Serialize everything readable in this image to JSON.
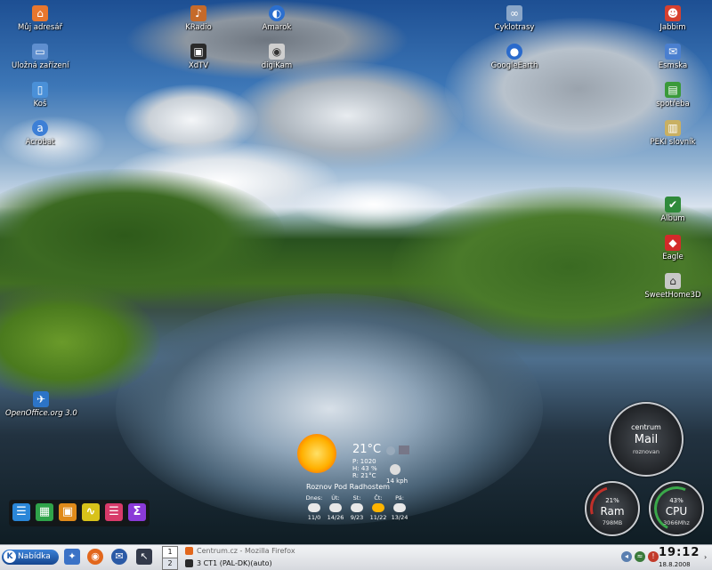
{
  "desktop_icons_left": [
    {
      "label": "Můj adresář",
      "icon": "home-icon",
      "color": "#e8772e",
      "glyph": "⌂"
    },
    {
      "label": "Uložná zařízení",
      "icon": "computer-icon",
      "color": "#5f8fcf",
      "glyph": "▭"
    },
    {
      "label": "Koš",
      "icon": "trash-icon",
      "color": "#4a90d8",
      "glyph": "▯"
    },
    {
      "label": "Acrobat",
      "icon": "adobe-acrobat-icon",
      "color": "#3d7fd6",
      "glyph": "a"
    }
  ],
  "desktop_icons_mid": [
    {
      "label": "KRadio",
      "icon": "radio-icon",
      "color": "#c56a2a",
      "glyph": "♪"
    },
    {
      "label": "XdTV",
      "icon": "tv-icon",
      "color": "#2a2a2a",
      "glyph": "▣"
    },
    {
      "label": "Amarok",
      "icon": "amarok-icon",
      "color": "#2b6fcf",
      "glyph": "◐"
    },
    {
      "label": "digiKam",
      "icon": "camera-icon",
      "color": "#cfcfcf",
      "glyph": "◉"
    },
    {
      "label": "Cyklotrasy",
      "icon": "bicycle-icon",
      "color": "#8aa6c8",
      "glyph": "∞"
    },
    {
      "label": "GoogleEarth",
      "icon": "globe-icon",
      "color": "#2a6acc",
      "glyph": "●"
    }
  ],
  "desktop_icons_right": [
    {
      "label": "Jabbim",
      "icon": "jabber-icon",
      "color": "#d6402f",
      "glyph": "☻"
    },
    {
      "label": "Esmska",
      "icon": "sms-icon",
      "color": "#4a7fcf",
      "glyph": "✉"
    },
    {
      "label": "spotřeba",
      "icon": "spreadsheet-icon",
      "color": "#3a9a3a",
      "glyph": "▤"
    },
    {
      "label": "PEKI slovník",
      "icon": "dictionary-icon",
      "color": "#c9b062",
      "glyph": "▥"
    },
    {
      "label": "Album",
      "icon": "album-icon",
      "color": "#2f8a3a",
      "glyph": "✔"
    },
    {
      "label": "Eagle",
      "icon": "eagle-icon",
      "color": "#d42a2a",
      "glyph": "◆"
    },
    {
      "label": "SweetHome3D",
      "icon": "house-3d-icon",
      "color": "#c8c8c8",
      "glyph": "⌂"
    }
  ],
  "openoffice": {
    "label": "OpenOffice.org 3.0",
    "icon": "openoffice-icon",
    "color": "#2c74c7",
    "glyph": "✈"
  },
  "weather": {
    "temperature": "21°C",
    "pressure": "P: 1020",
    "humidity": "H: 43 %",
    "realfeel": "R: 21°C",
    "wind": "14 kph",
    "city": "Roznov Pod Radhostem",
    "days": [
      {
        "day": "Dnes:",
        "range": "11/0",
        "sunny": false
      },
      {
        "day": "Út:",
        "range": "14/26",
        "sunny": false
      },
      {
        "day": "St:",
        "range": "9/23",
        "sunny": false
      },
      {
        "day": "Čt:",
        "range": "11/22",
        "sunny": true
      },
      {
        "day": "Pá:",
        "range": "13/24",
        "sunny": false
      }
    ]
  },
  "mail_widget": {
    "title": "centrum",
    "label": "Mail",
    "sub": "roznovan"
  },
  "ram_gauge": {
    "percent": "21%",
    "label": "Ram",
    "sub": "798MB",
    "fill": 0.21
  },
  "cpu_gauge": {
    "percent": "43%",
    "label": "CPU",
    "sub": "3066Mhz",
    "fill": 0.43
  },
  "dock": [
    {
      "icon": "list-icon",
      "color": "#2a86d8",
      "glyph": "☰"
    },
    {
      "icon": "grid-icon",
      "color": "#2fa34a",
      "glyph": "▦"
    },
    {
      "icon": "window-icon",
      "color": "#e08a1a",
      "glyph": "▣"
    },
    {
      "icon": "curve-icon",
      "color": "#d8c21a",
      "glyph": "∿"
    },
    {
      "icon": "database-icon",
      "color": "#d83a6a",
      "glyph": "☰"
    },
    {
      "icon": "sigma-icon",
      "color": "#8a3ad8",
      "glyph": "Σ"
    }
  ],
  "taskbar": {
    "start_label": "Nabídka",
    "quick_launch": [
      {
        "icon": "kde-icon",
        "color": "#3a72c6",
        "glyph": "✦"
      },
      {
        "icon": "firefox-icon",
        "color": "#e2671c",
        "glyph": "◉"
      },
      {
        "icon": "thunderbird-icon",
        "color": "#2a5aa6",
        "glyph": "✉"
      },
      {
        "icon": "show-desktop-icon",
        "color": "#333a4a",
        "glyph": "↖"
      }
    ],
    "pager": [
      "1",
      "2"
    ],
    "tasks": [
      "Centrum.cz - Mozilla Firefox",
      "3  CT1 (PAL-DK)(auto)"
    ],
    "clock": "19:12",
    "date": "18.8.2008"
  }
}
